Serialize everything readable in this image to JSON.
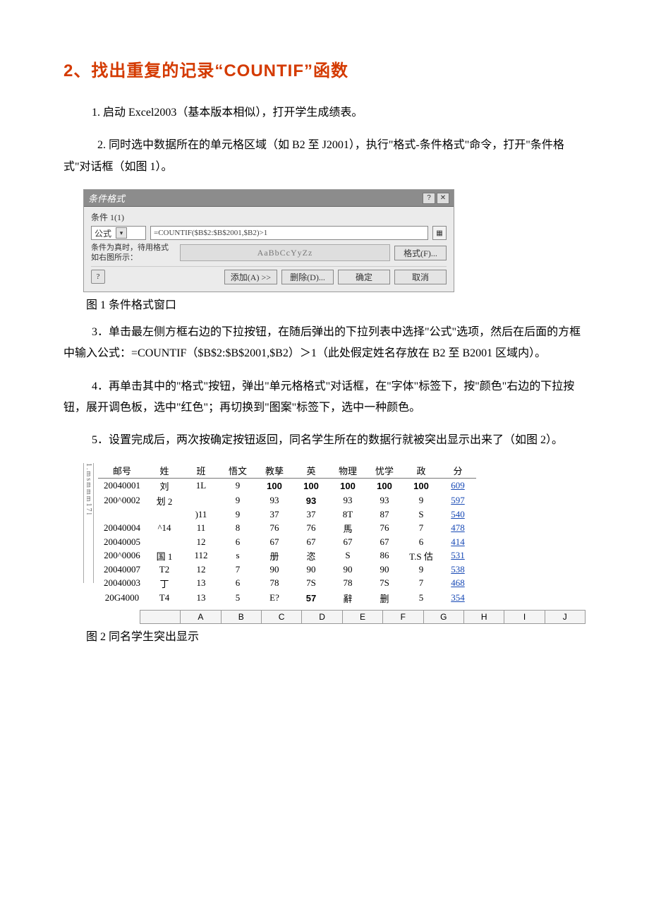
{
  "heading": "2、找出重复的记录“COUNTIF”函数",
  "step1": "1. 启动 Excel2003（基本版本相似），打开学生成绩表。",
  "step2": "2.   同时选中数据所在的单元格区域（如 B2 至 J2001），执行\"格式-条件格式\"命令，打开\"条件格式\"对话框（如图 1）。",
  "fig1caption": "图 1 条件格式窗口",
  "step3": "3．单击最左侧方框右边的下拉按钮，在随后弹出的下拉列表中选择\"公式\"选项，然后在后面的方框中输入公式：=COUNTIF（$B$2:$B$2001,$B2）＞1（此处假定姓名存放在 B2 至 B2001 区域内）。",
  "step4": "4．再单击其中的\"格式\"按钮，弹出\"单元格格式\"对话框，在\"字体\"标签下，按\"颜色\"右边的下拉按钮，展开调色板，选中\"红色\"；再切换到\"图案\"标签下，选中一种颜色。",
  "step5": "5．设置完成后，两次按确定按钮返回，同名学生所在的数据行就被突出显示出来了（如图 2）。",
  "fig2caption": "图 2 同名学生突出显示",
  "dialog": {
    "title": "条件格式",
    "group": "条件 1(1)",
    "type_label": "公式",
    "formula": "=COUNTIF($B$2:$B$2001,$B2)>1",
    "hint": "条件为真时，待用格式如右图所示：",
    "preview": "AaBbCcYyZz",
    "fmtbtn": "格式(F)...",
    "addbtn": "添加(A) >>",
    "delbtn": "删除(D)...",
    "okbtn": "确定",
    "cancelbtn": "取消"
  },
  "rowgutter": "1.msmmm17l",
  "table": {
    "headers": [
      "邮号",
      "姓",
      "班",
      "悟文",
      "教孳",
      "英",
      "物理",
      "忧学",
      "政",
      "分"
    ],
    "rows": [
      [
        "20040001",
        "刘",
        "1L",
        "9",
        "100",
        "100",
        "100",
        "100",
        "100",
        "609"
      ],
      [
        "200^0002",
        "划 2",
        "",
        "9",
        "93",
        "93",
        "93",
        "93",
        "9",
        "597"
      ],
      [
        "",
        "",
        ")11",
        "9",
        "37",
        "37",
        "8T",
        "87",
        "S",
        "540"
      ],
      [
        "20040004",
        "^14",
        "11",
        "8",
        "76",
        "76",
        "馬",
        "76",
        "7",
        "478"
      ],
      [
        "20040005",
        "",
        "12",
        "6",
        "67",
        "67",
        "67",
        "67",
        "6",
        "414"
      ],
      [
        "200^0006",
        "国 1",
        "112",
        "s",
        "册",
        "恣",
        "S",
        "86",
        "T.S 估",
        "531"
      ],
      [
        "20040007",
        "T2",
        "12",
        "7",
        "90",
        "90",
        "90",
        "90",
        "9",
        "538"
      ],
      [
        "20040003",
        "丁",
        "13",
        "6",
        "78",
        "7S",
        "78",
        "7S",
        "7",
        "468"
      ],
      [
        "20G4000",
        "T4",
        "13",
        "5",
        "E?",
        "57",
        "辭",
        "删",
        "5",
        "354"
      ]
    ]
  },
  "colheaders": [
    "",
    "A",
    "B",
    "C",
    "D",
    "E",
    "F",
    "G",
    "H",
    "I",
    "J"
  ]
}
